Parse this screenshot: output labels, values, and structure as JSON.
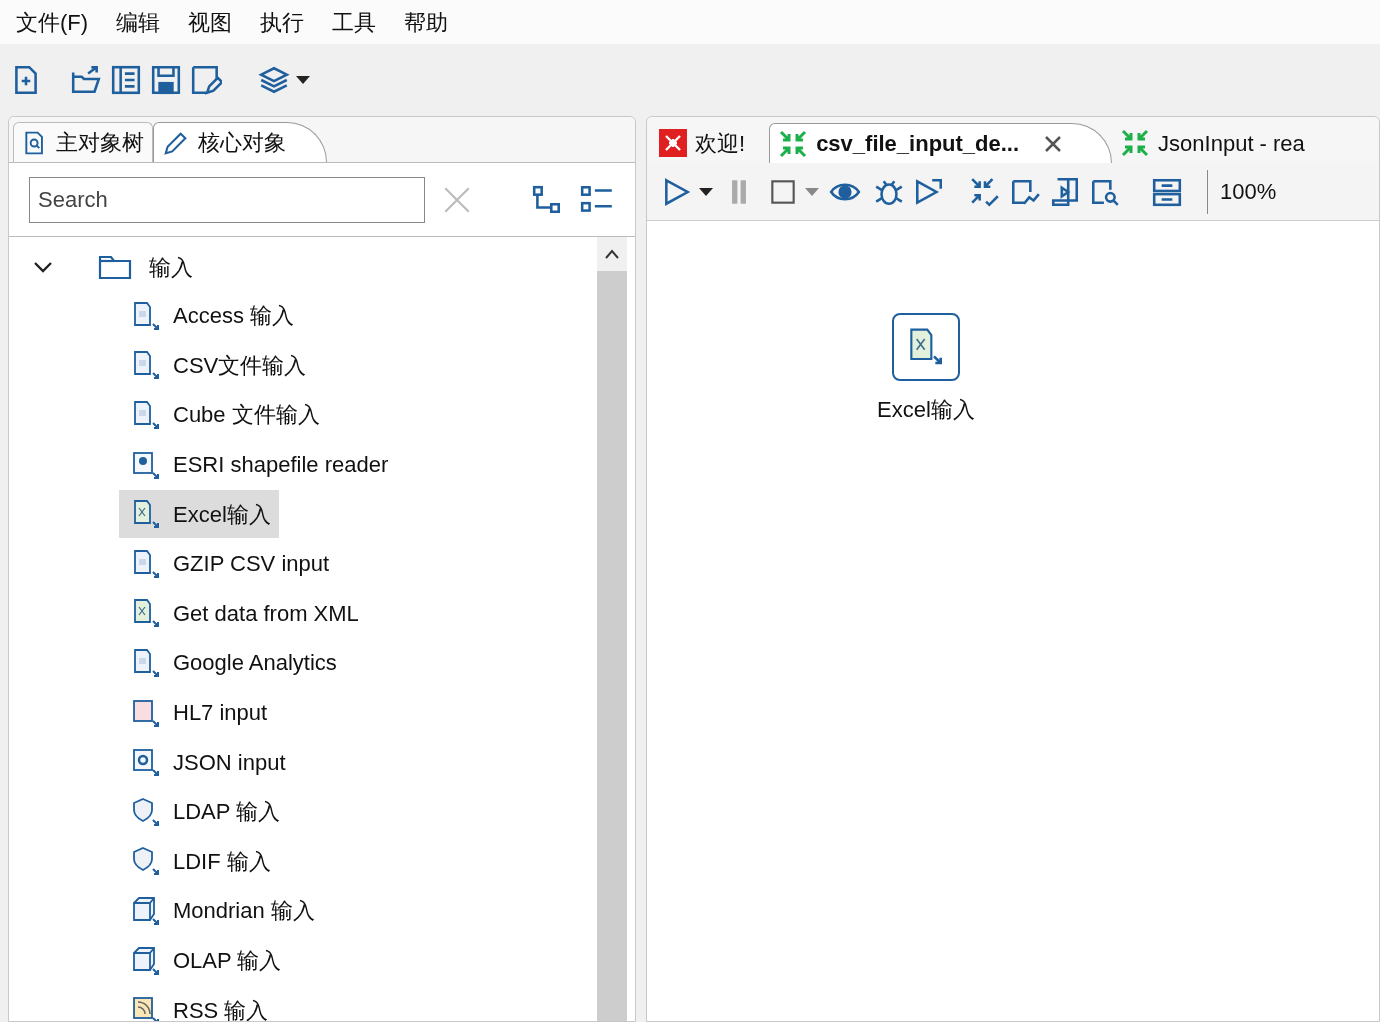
{
  "menu": [
    "文件(F)",
    "编辑",
    "视图",
    "执行",
    "工具",
    "帮助"
  ],
  "left_tabs": [
    {
      "label": "主对象树",
      "kind": "tree",
      "selected": false
    },
    {
      "label": "核心对象",
      "kind": "pencil",
      "selected": true
    }
  ],
  "search": {
    "placeholder": "Search"
  },
  "tree": {
    "label": "输入",
    "expanded": true,
    "children": [
      {
        "label": "Access 输入",
        "kind": "doc",
        "selected": false
      },
      {
        "label": "CSV文件输入",
        "kind": "doc",
        "selected": false
      },
      {
        "label": "Cube 文件输入",
        "kind": "doc",
        "selected": false
      },
      {
        "label": "ESRI shapefile reader",
        "kind": "pin",
        "selected": false
      },
      {
        "label": "Excel输入",
        "kind": "sheet",
        "selected": true
      },
      {
        "label": "GZIP CSV input",
        "kind": "doc",
        "selected": false
      },
      {
        "label": "Get data from XML",
        "kind": "sheet",
        "selected": false
      },
      {
        "label": "Google Analytics",
        "kind": "doc",
        "selected": false
      },
      {
        "label": "HL7 input",
        "kind": "pink",
        "selected": false
      },
      {
        "label": "JSON input",
        "kind": "ring",
        "selected": false
      },
      {
        "label": "LDAP 输入",
        "kind": "shield",
        "selected": false
      },
      {
        "label": "LDIF 输入",
        "kind": "shield",
        "selected": false
      },
      {
        "label": "Mondrian 输入",
        "kind": "cube",
        "selected": false
      },
      {
        "label": "OLAP 输入",
        "kind": "cube",
        "selected": false
      },
      {
        "label": "RSS 输入",
        "kind": "rss",
        "selected": false
      }
    ]
  },
  "editor_tabs": [
    {
      "label": "欢迎!",
      "kind": "welcome",
      "selected": false,
      "closable": false
    },
    {
      "label": "csv_file_input_de...",
      "kind": "transform",
      "selected": true,
      "closable": true
    },
    {
      "label": "JsonInput - rea",
      "kind": "transform",
      "selected": false,
      "closable": false
    }
  ],
  "zoom": "100%",
  "canvas_steps": [
    {
      "label": "Excel输入"
    }
  ]
}
